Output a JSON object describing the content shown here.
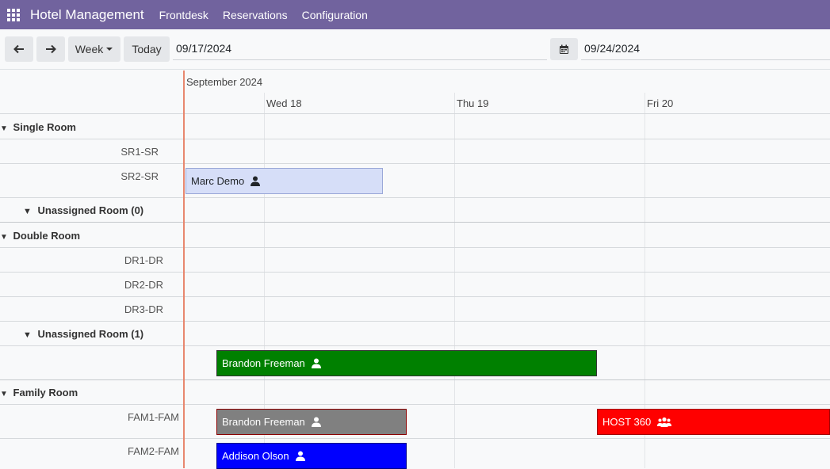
{
  "app": {
    "title": "Hotel Management",
    "menu": [
      "Frontdesk",
      "Reservations",
      "Configuration"
    ]
  },
  "toolbar": {
    "scale_label": "Week",
    "today_label": "Today",
    "start_date": "09/17/2024",
    "end_date": "09/24/2024"
  },
  "gantt": {
    "month_label": "September 2024",
    "days": [
      "Wed 18",
      "Thu 19",
      "Fri 20"
    ],
    "groups": [
      {
        "label": "Single Room",
        "rows": [
          "SR1-SR",
          "SR2-SR"
        ],
        "unassigned": "Unassigned Room (0)"
      },
      {
        "label": "Double Room",
        "rows": [
          "DR1-DR",
          "DR2-DR",
          "DR3-DR"
        ],
        "unassigned": "Unassigned Room (1)"
      },
      {
        "label": "Family Room",
        "rows": [
          "FAM1-FAM",
          "FAM2-FAM"
        ]
      }
    ],
    "bookings": [
      {
        "guest": "Marc Demo",
        "row": "SR2-SR",
        "icon": "user-icon",
        "color": "#d6def8",
        "text_color": "#212529"
      },
      {
        "guest": "Brandon Freeman",
        "row": "Unassigned Room (1)",
        "icon": "user-icon",
        "color": "#008000",
        "text_color": "#ffffff"
      },
      {
        "guest": "Brandon Freeman",
        "row": "FAM1-FAM",
        "icon": "user-icon",
        "color": "#808080",
        "text_color": "#ffffff"
      },
      {
        "guest": "HOST 360",
        "row": "FAM1-FAM",
        "icon": "users-icon",
        "color": "#ff0000",
        "text_color": "#ffffff"
      },
      {
        "guest": "Addison Olson",
        "row": "FAM2-FAM",
        "icon": "user-icon",
        "color": "#0000ff",
        "text_color": "#ffffff"
      }
    ]
  }
}
